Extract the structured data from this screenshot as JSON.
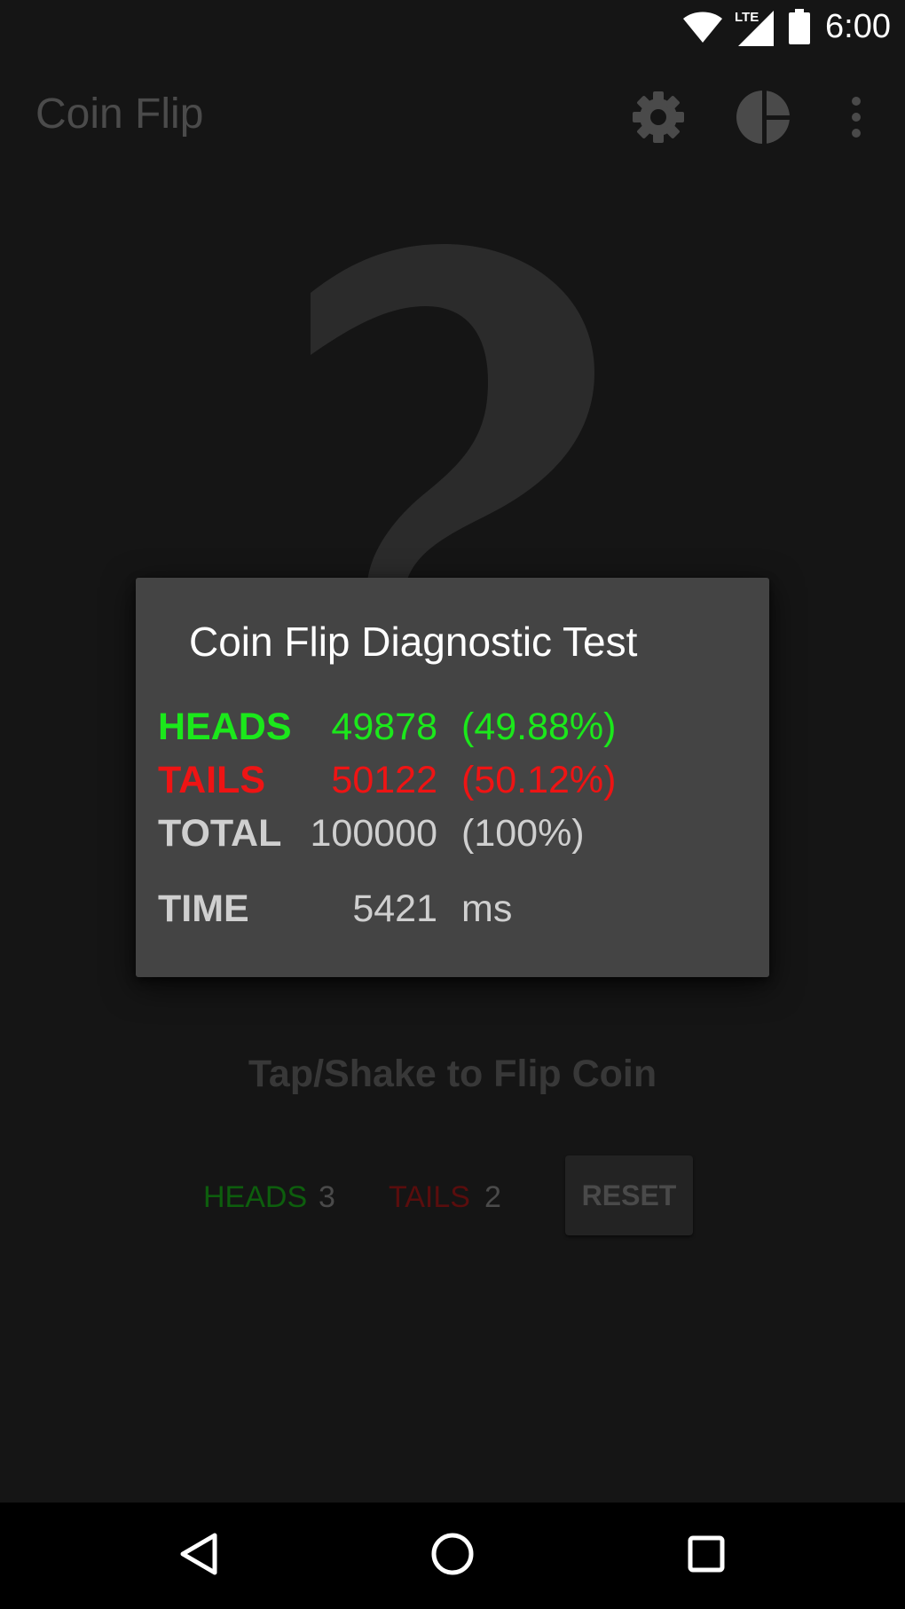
{
  "status_bar": {
    "time": "6:00",
    "network_label": "LTE",
    "icons": [
      "wifi-icon",
      "lte-signal-icon",
      "battery-icon"
    ]
  },
  "app_bar": {
    "title": "Coin Flip",
    "actions": [
      "gear-icon",
      "pie-chart-icon",
      "overflow-menu-icon"
    ]
  },
  "coin": {
    "face": "question-mark-icon"
  },
  "main": {
    "hint": "Tap/Shake to Flip Coin",
    "heads_label": "HEADS",
    "heads_count": "3",
    "tails_label": "TAILS",
    "tails_count": "2",
    "reset_label": "RESET"
  },
  "dialog": {
    "title": "Coin Flip Diagnostic Test",
    "rows": [
      {
        "label": "HEADS",
        "count": "49878",
        "pct": "(49.88%)",
        "color": "#1be81b"
      },
      {
        "label": "TAILS",
        "count": "50122",
        "pct": "(50.12%)",
        "color": "#ee1414"
      },
      {
        "label": "TOTAL",
        "count": "100000",
        "pct": "(100%)",
        "color": "#cfcfcf"
      },
      {
        "label": "TIME",
        "count": "5421",
        "pct": "ms",
        "color": "#cfcfcf"
      }
    ]
  },
  "nav_bar": {
    "buttons": [
      "back-icon",
      "home-icon",
      "recents-icon"
    ]
  },
  "colors": {
    "background": "#151515",
    "dialog": "#444444",
    "heads": "#1be81b",
    "tails": "#ee1414",
    "neutral": "#cfcfcf"
  }
}
